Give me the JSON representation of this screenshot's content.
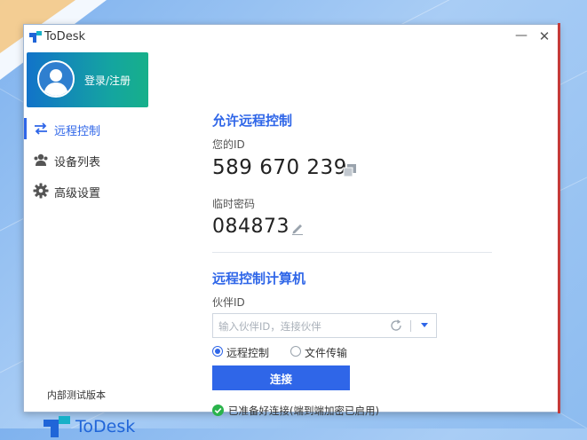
{
  "window": {
    "title": "ToDesk",
    "min_symbol": "—",
    "close_symbol": "✕"
  },
  "sidebar": {
    "login_label": "登录/注册",
    "items": [
      {
        "label": "远程控制",
        "icon": "swap-arrows-icon",
        "active": true
      },
      {
        "label": "设备列表",
        "icon": "users-icon",
        "active": false
      },
      {
        "label": "高级设置",
        "icon": "gear-icon",
        "active": false
      }
    ],
    "version_label": "内部测试版本",
    "brand_name": "ToDesk"
  },
  "allow_remote": {
    "title": "允许远程控制",
    "id_label": "您的ID",
    "id_value": "589 670 239",
    "password_label": "临时密码",
    "password_value": "084873"
  },
  "control_remote": {
    "title": "远程控制计算机",
    "partner_label": "伙伴ID",
    "partner_placeholder": "输入伙伴ID，连接伙伴",
    "partner_value": "",
    "modes": [
      {
        "label": "远程控制",
        "checked": true
      },
      {
        "label": "文件传输",
        "checked": false
      }
    ],
    "connect_label": "连接",
    "status_text": "已准备好连接(端到端加密已启用)"
  },
  "colors": {
    "accent": "#2f66e8",
    "status_ok": "#2ab34b",
    "close_edge": "#c43a3a"
  }
}
